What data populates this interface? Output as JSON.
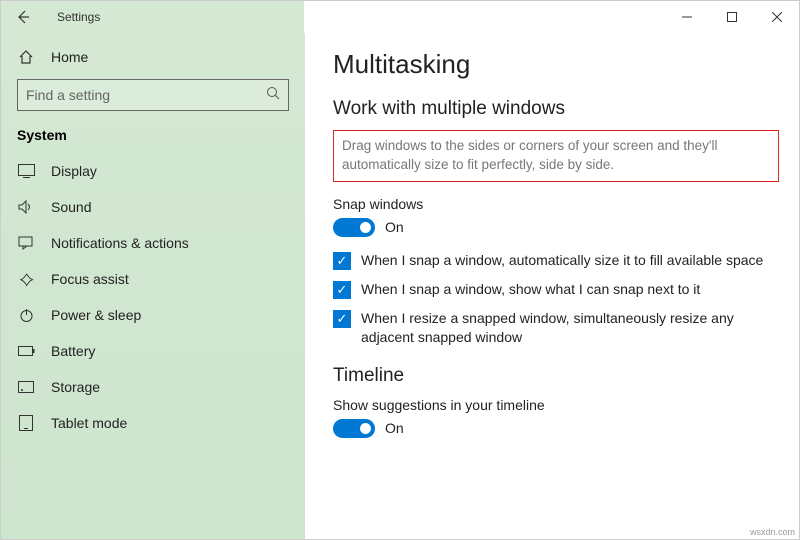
{
  "titlebar": {
    "title": "Settings"
  },
  "sidebar": {
    "home": "Home",
    "search_placeholder": "Find a setting",
    "section": "System",
    "items": [
      {
        "label": "Display"
      },
      {
        "label": "Sound"
      },
      {
        "label": "Notifications & actions"
      },
      {
        "label": "Focus assist"
      },
      {
        "label": "Power & sleep"
      },
      {
        "label": "Battery"
      },
      {
        "label": "Storage"
      },
      {
        "label": "Tablet mode"
      }
    ]
  },
  "main": {
    "title": "Multitasking",
    "section1": "Work with multiple windows",
    "desc": "Drag windows to the sides or corners of your screen and they'll automatically size to fit perfectly, side by side.",
    "snap_label": "Snap windows",
    "toggle1_state": "On",
    "cb1": "When I snap a window, automatically size it to fill available space",
    "cb2": "When I snap a window, show what I can snap next to it",
    "cb3": "When I resize a snapped window, simultaneously resize any adjacent snapped window",
    "section2": "Timeline",
    "timeline_label": "Show suggestions in your timeline",
    "toggle2_state": "On"
  },
  "watermark": "wsxdn.com"
}
